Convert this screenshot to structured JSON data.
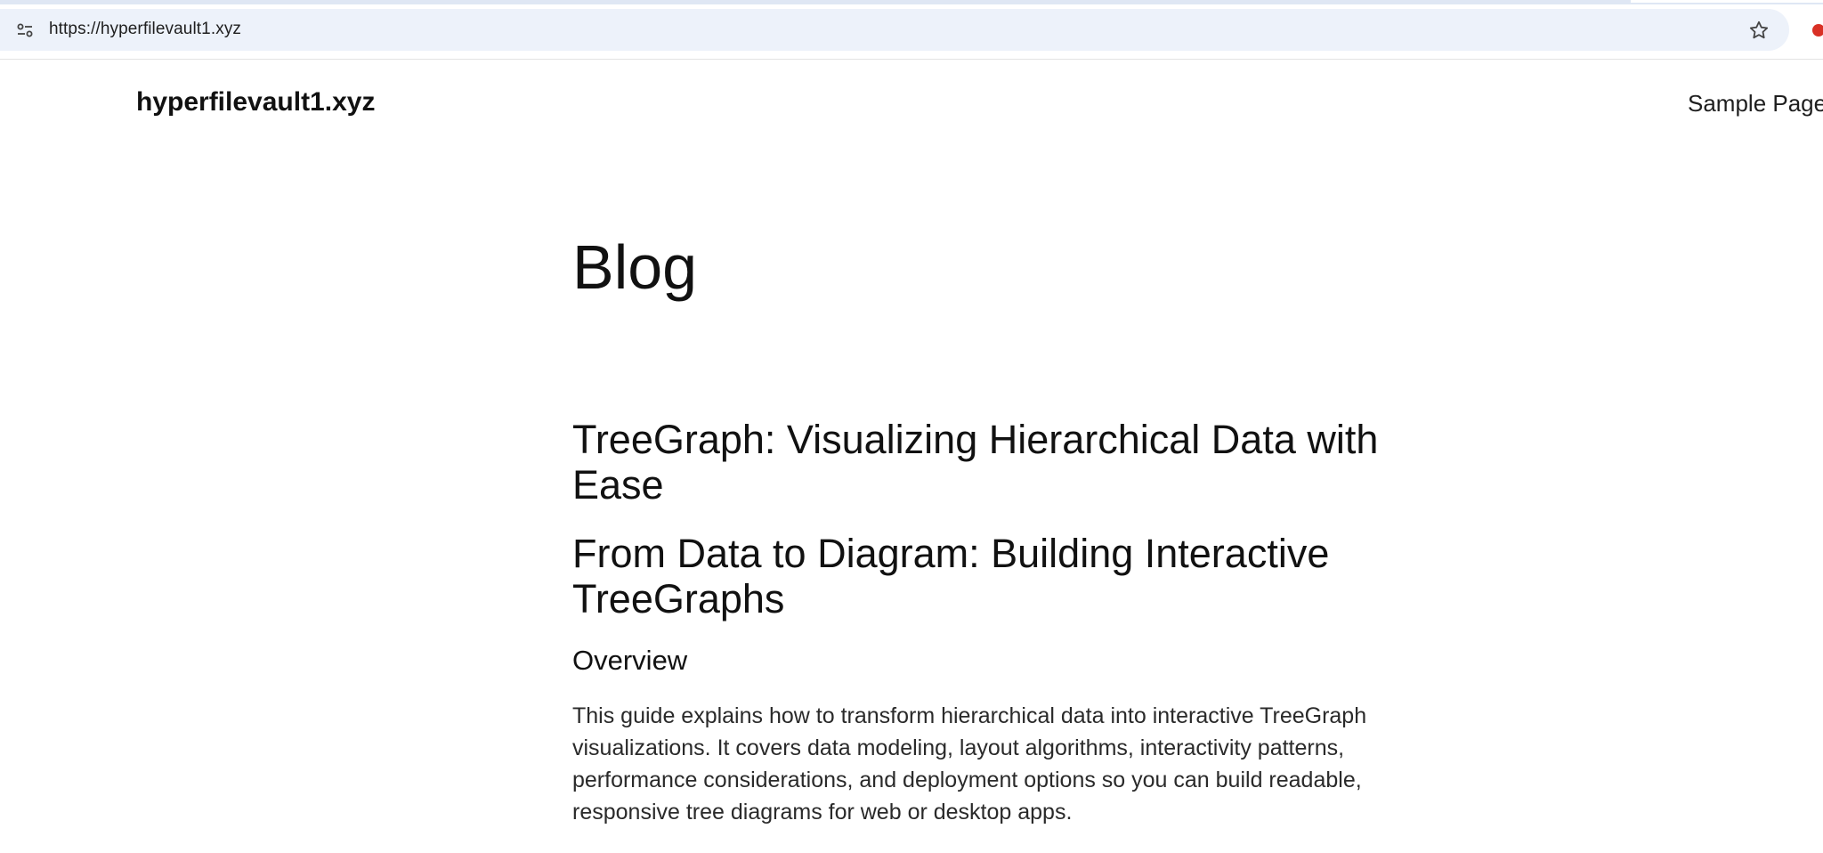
{
  "browser": {
    "url": "https://hyperfilevault1.xyz",
    "icons": {
      "site_info": "tune-icon",
      "bookmark": "star-icon",
      "extension": "extension-icon"
    }
  },
  "site": {
    "title": "hyperfilevault1.xyz",
    "nav": {
      "sample_page": "Sample Page"
    }
  },
  "main": {
    "page_heading": "Blog",
    "post_title": "TreeGraph: Visualizing Hierarchical Data with Ease",
    "sub_heading": "From Data to Diagram: Building Interactive TreeGraphs",
    "overview_heading": "Overview",
    "overview_text": "This guide explains how to transform hierarchical data into interactive TreeGraph visualizations. It covers data modeling, layout algorithms, interactivity patterns, performance considerations, and deployment options so you can build readable, responsive tree diagrams for web or desktop apps."
  },
  "colors": {
    "urlbar_bg": "#edf2fa",
    "text": "#111111",
    "extension_accent": "#d93025"
  }
}
